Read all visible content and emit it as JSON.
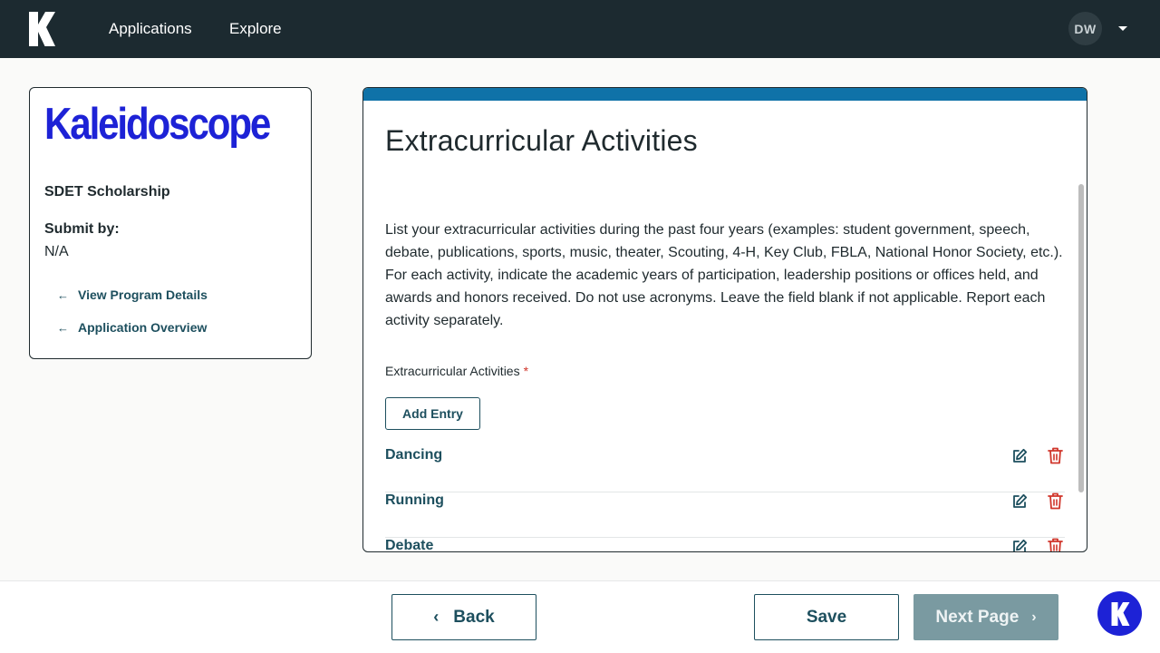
{
  "nav": {
    "brand_icon": "k-logo-icon",
    "links": [
      "Applications",
      "Explore"
    ],
    "avatar_initials": "DW",
    "avatar_menu_icon": "caret-down-icon"
  },
  "sidebar": {
    "logo_text": "Kaleidoscope",
    "program_name": "SDET Scholarship",
    "submit_by_label": "Submit by:",
    "submit_by_value": "N/A",
    "links": [
      {
        "label": "View Program Details",
        "icon": "arrow-left-icon"
      },
      {
        "label": "Application Overview",
        "icon": "arrow-left-icon"
      }
    ]
  },
  "main": {
    "title": "Extracurricular Activities",
    "description": "List your extracurricular activities during the past four years (examples: student government, speech, debate, publications, sports, music, theater, Scouting, 4-H, Key Club, FBLA, National Honor Society, etc.). For each activity, indicate the academic years of participation, leadership positions or offices held, and awards and honors received. Do not use acronyms. Leave the field blank if not applicable. Report each activity separately.",
    "field_label": "Extracurricular Activities",
    "required_marker": "*",
    "add_entry_label": "Add Entry",
    "entries": [
      "Dancing",
      "Running",
      "Debate"
    ],
    "entry_icons": {
      "edit": "edit-icon",
      "delete": "trash-icon"
    }
  },
  "footer": {
    "back_label": "Back",
    "save_label": "Save",
    "next_label": "Next Page",
    "help_icon": "k-help-icon"
  },
  "colors": {
    "nav_bg": "#1c2a30",
    "accent_bar": "#0f72a8",
    "brand_blue": "#1d22d6",
    "primary_teal": "#1d4f5e",
    "delete_red": "#d0362b",
    "next_disabled": "#7a9aa1"
  }
}
